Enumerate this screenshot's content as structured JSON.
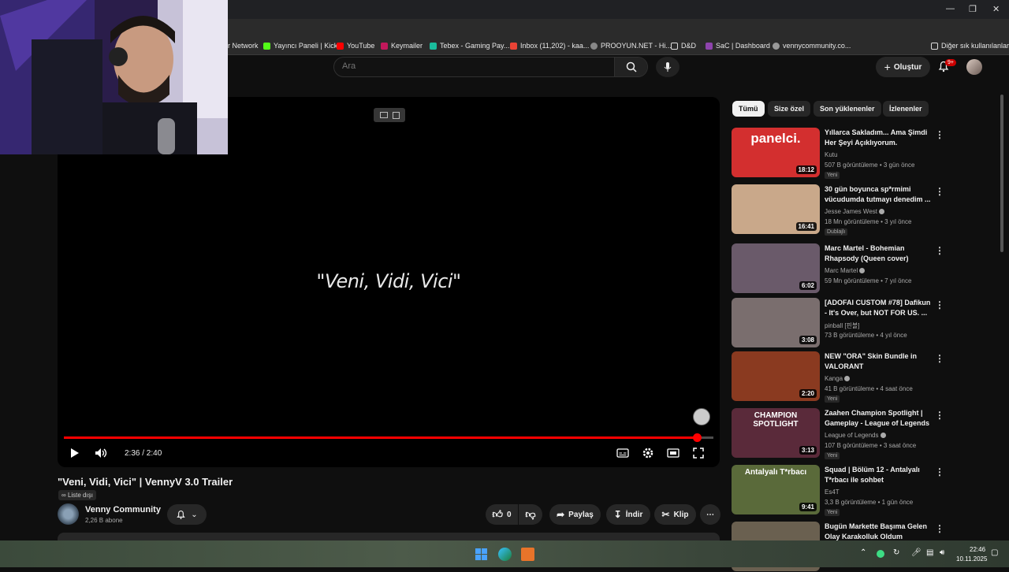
{
  "bookmarks": [
    {
      "label": "r Network",
      "color": "#00000000"
    },
    {
      "label": "Yayıncı Paneli | Kick",
      "color": "#53fc18"
    },
    {
      "label": "YouTube",
      "color": "#ff0000"
    },
    {
      "label": "Keymailer",
      "color": "#c2185b"
    },
    {
      "label": "Tebex - Gaming Pay...",
      "color": "#1abc9c"
    },
    {
      "label": "Inbox (11,202) - kaa...",
      "color": "#ea4335"
    },
    {
      "label": "PROOYUN.NET - Hi...",
      "color": "#888888"
    },
    {
      "label": "D&D",
      "color": "#dddddd"
    },
    {
      "label": "SaC | Dashboard",
      "color": "#8e44ad"
    },
    {
      "label": "vennycommunity.co...",
      "color": "#999999"
    }
  ],
  "bookmarks_other": "Diğer sık kullanılanlar",
  "header": {
    "search_placeholder": "Ara",
    "create_label": "Oluştur",
    "notif_count": "9+"
  },
  "player": {
    "quote": "\"Veni, Vidi, Vici\"",
    "time": "2:36 / 2:40",
    "progress": 0.975
  },
  "video": {
    "title": "\"Veni, Vidi, Vici\" | VennyV 3.0 Trailer",
    "unlisted": "Liste dışı",
    "channel": "Venny Community",
    "subs": "2,26 B abone",
    "likes": "0",
    "share": "Paylaş",
    "download": "İndir",
    "clip": "Klip"
  },
  "chips": [
    "Tümü",
    "Size özel",
    "Son yüklenenler",
    "İzlenenler"
  ],
  "recommendations": [
    {
      "title": "Yıllarca Sakladım... Ama Şimdi Her Şeyi Açıklıyorum.",
      "channel": "Kutu",
      "verified": false,
      "meta": "507 B görüntüleme • 3 gün önce",
      "badge": "Yeni",
      "duration": "18:12",
      "thumb_text": "panelci.",
      "thumb_bg": "#d32f2f"
    },
    {
      "title": "30 gün boyunca sp*rmimi vücudumda tutmayı denedim ...",
      "channel": "Jesse James West",
      "verified": true,
      "meta": "18 Mn görüntüleme • 3 yıl önce",
      "badge": "Dublajlı",
      "duration": "16:41",
      "thumb_text": "",
      "thumb_bg": "#c9a88a"
    },
    {
      "title": "Marc Martel - Bohemian Rhapsody (Queen cover)",
      "channel": "Marc Martel",
      "verified": true,
      "meta": "59 Mn görüntüleme • 7 yıl önce",
      "badge": "",
      "duration": "6:02",
      "thumb_text": "",
      "thumb_bg": "#6a5a6a"
    },
    {
      "title": "[ADOFAI CUSTOM #78] Dafikun - It's Over, but NOT FOR US. ...",
      "channel": "pinball [핀볼]",
      "verified": false,
      "meta": "73 B görüntüleme • 4 yıl önce",
      "badge": "",
      "duration": "3:08",
      "thumb_text": "",
      "thumb_bg": "#7a6e6e"
    },
    {
      "title": "NEW \"ORA\" Skin Bundle in VALORANT",
      "channel": "Kanga",
      "verified": true,
      "meta": "41 B görüntüleme • 4 saat önce",
      "badge": "Yeni",
      "duration": "2:20",
      "thumb_text": "",
      "thumb_bg": "#8a3a20"
    },
    {
      "title": "Zaahen Champion Spotlight | Gameplay - League of Legends",
      "channel": "League of Legends",
      "verified": true,
      "meta": "107 B görüntüleme • 3 saat önce",
      "badge": "Yeni",
      "duration": "3:13",
      "thumb_text": "CHAMPION SPOTLIGHT",
      "thumb_bg": "#5a2a3a"
    },
    {
      "title": "Squad | Bölüm 12 - Antalyalı T*rbacı ile sohbet",
      "channel": "Es4T",
      "verified": false,
      "meta": "3,3 B görüntüleme • 1 gün önce",
      "badge": "Yeni",
      "duration": "9:41",
      "thumb_text": "Antalyalı T*rbacı",
      "thumb_bg": "#5a6a3a"
    },
    {
      "title": "Bugün Markette Başıma Gelen Olay Karakolluk Oldum",
      "channel": "",
      "verified": false,
      "meta": "",
      "badge": "",
      "duration": "",
      "thumb_text": "",
      "thumb_bg": "#6a6050"
    }
  ],
  "taskbar": {
    "time": "22:46",
    "date": "10.11.2025"
  }
}
